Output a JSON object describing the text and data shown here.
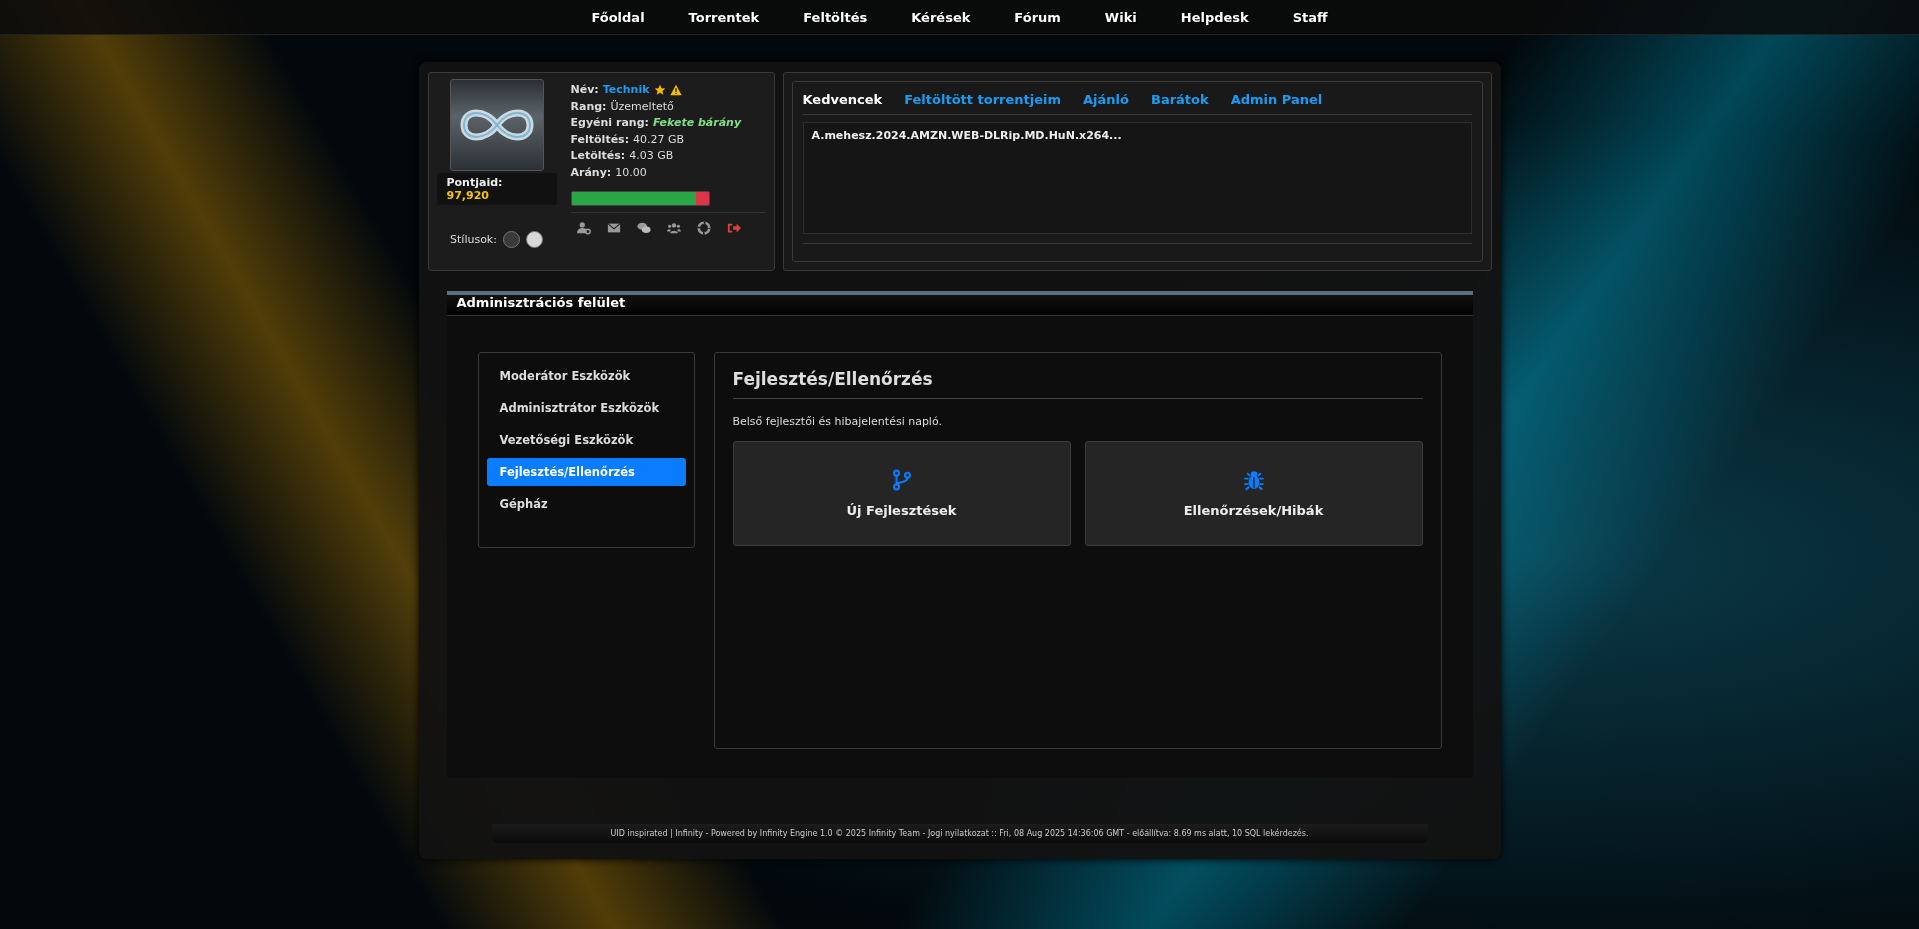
{
  "nav": [
    {
      "label": "Főoldal"
    },
    {
      "label": "Torrentek"
    },
    {
      "label": "Feltöltés"
    },
    {
      "label": "Kérések"
    },
    {
      "label": "Fórum"
    },
    {
      "label": "Wiki"
    },
    {
      "label": "Helpdesk"
    },
    {
      "label": "Staff"
    }
  ],
  "profile": {
    "points_label": "Pontjaid:",
    "points": "97,920",
    "styles_label": "Stílusok:",
    "styles": [
      {
        "color": "#3a3a3a",
        "selected": false
      },
      {
        "color": "#d8d8d8",
        "selected": false
      }
    ],
    "fields": [
      {
        "kind": "name",
        "label": "Név:",
        "value": "Technik"
      },
      {
        "kind": "plain",
        "label": "Rang:",
        "value": "Üzemeltető"
      },
      {
        "kind": "custom",
        "label": "Egyéni rang:",
        "value": "Fekete bárány"
      },
      {
        "kind": "plain",
        "label": "Feltöltés:",
        "value": "40.27 GB"
      },
      {
        "kind": "plain",
        "label": "Letöltés:",
        "value": "4.03 GB"
      },
      {
        "kind": "plain",
        "label": "Arány:",
        "value": "10.00"
      }
    ],
    "ratio": {
      "level": 0.91
    }
  },
  "tabs": [
    {
      "label": "Kedvencek",
      "selected": true
    },
    {
      "label": "Feltöltött torrentjeim",
      "selected": false
    },
    {
      "label": "Ajánló",
      "selected": false
    },
    {
      "label": "Barátok",
      "selected": false
    },
    {
      "label": "Admin Panel",
      "selected": false
    }
  ],
  "favorites": [
    "A.mehesz.2024.AMZN.WEB-DLRip.MD.HuN.x264..."
  ],
  "admin": {
    "title": "Adminisztrációs felület",
    "menu": [
      {
        "label": "Moderátor Eszközök",
        "selected": false
      },
      {
        "label": "Adminisztrátor Eszközök",
        "selected": false
      },
      {
        "label": "Vezetőségi Eszközök",
        "selected": false
      },
      {
        "label": "Fejlesztés/Ellenőrzés",
        "selected": true
      },
      {
        "label": "Gépház",
        "selected": false
      }
    ],
    "heading": "Fejlesztés/Ellenőrzés",
    "description": "Belső fejlesztői és hibajelentési napló.",
    "cards": [
      {
        "kind": "branch",
        "label": "Új Fejlesztések"
      },
      {
        "kind": "bug",
        "label": "Ellenőrzések/Hibák"
      }
    ]
  },
  "footer": "UID inspirated | Infinity - Powered by Infinity Engine 1.0 © 2025 Infinity Team - Jogi nyilatkozat :: Fri, 08 Aug 2025 14:36:06 GMT - előállítva: 8.69 ms alatt, 10 SQL lekérdezés."
}
